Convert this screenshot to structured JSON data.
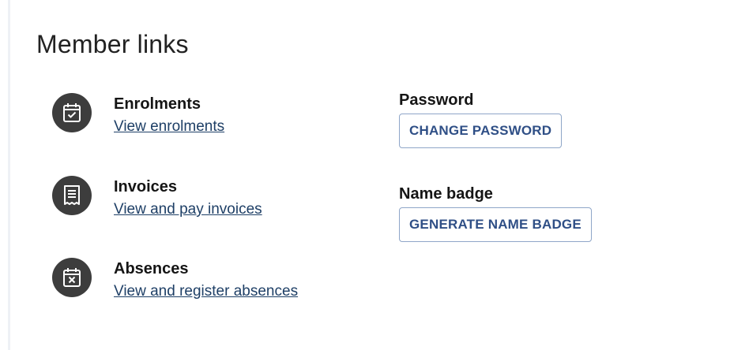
{
  "title": "Member links",
  "member_links": [
    {
      "heading": "Enrolments",
      "link": "View enrolments",
      "icon": "calendar-check-icon"
    },
    {
      "heading": "Invoices",
      "link": "View and pay invoices",
      "icon": "receipt-icon"
    },
    {
      "heading": "Absences",
      "link": "View and register absences",
      "icon": "calendar-x-icon"
    }
  ],
  "actions": {
    "password": {
      "heading": "Password",
      "button": "CHANGE PASSWORD"
    },
    "name_badge": {
      "heading": "Name badge",
      "button": "GENERATE NAME BADGE"
    }
  },
  "colors": {
    "icon_background": "#3d3d3d",
    "link": "#1e3f66",
    "button_text": "#2f4f86",
    "button_border": "#8fa6c8"
  }
}
